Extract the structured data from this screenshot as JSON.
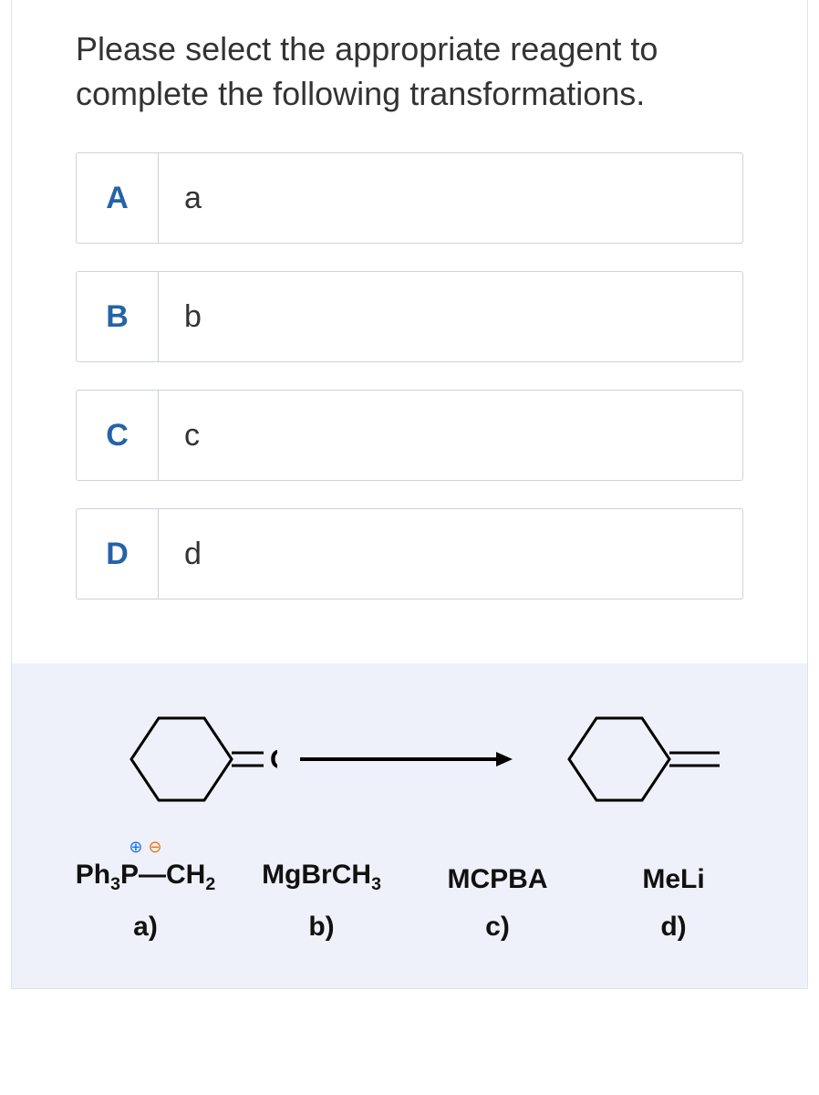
{
  "prompt": "Please select the appropriate reagent to complete the following transformations.",
  "answers": [
    {
      "letter": "A",
      "value": "a"
    },
    {
      "letter": "B",
      "value": "b"
    },
    {
      "letter": "C",
      "value": "c"
    },
    {
      "letter": "D",
      "value": "d"
    }
  ],
  "reaction": {
    "left_structure": "cyclohexanone",
    "left_label": "O",
    "right_structure": "methylenecyclohexane"
  },
  "reagents": [
    {
      "formula_html": "Ph<sub>3</sub>P—CH<sub>2</sub>",
      "has_charges": true,
      "label": "a)"
    },
    {
      "formula_html": "MgBrCH<sub>3</sub>",
      "has_charges": false,
      "label": "b)"
    },
    {
      "formula_html": "MCPBA",
      "has_charges": false,
      "label": "c)"
    },
    {
      "formula_html": "MeLi",
      "has_charges": false,
      "label": "d)"
    }
  ]
}
